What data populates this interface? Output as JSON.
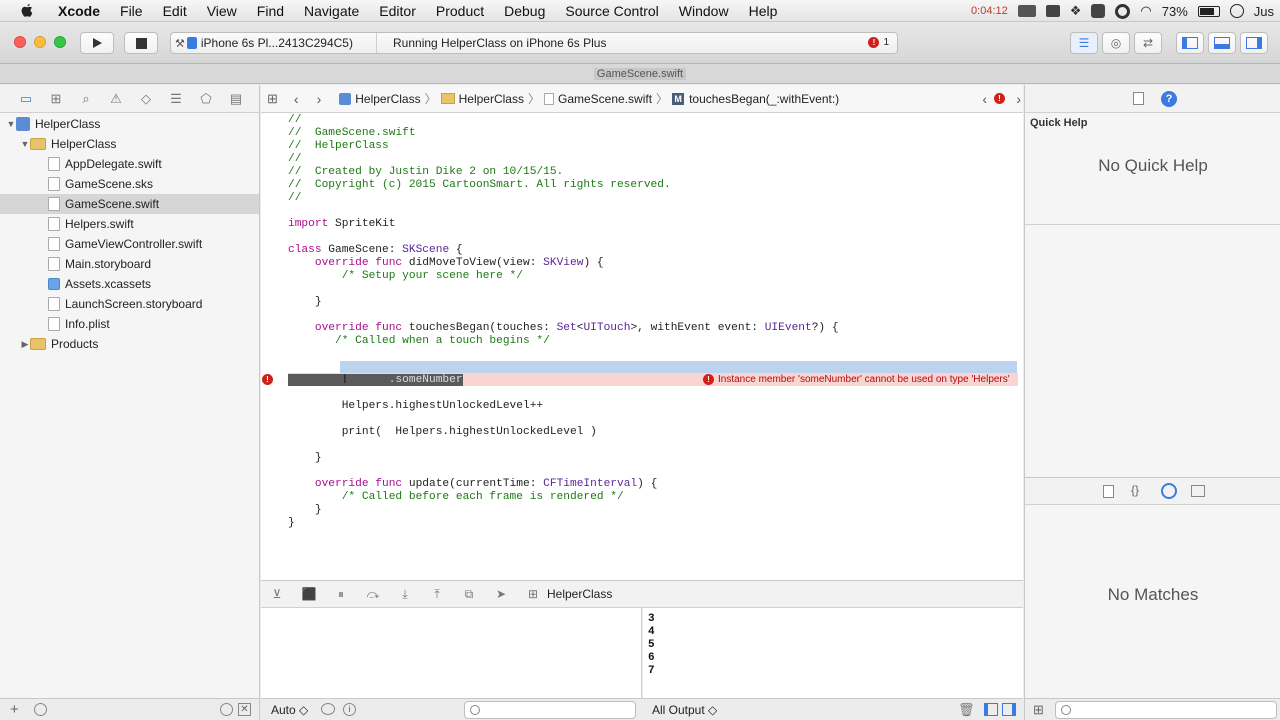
{
  "menubar": {
    "app": "Xcode",
    "items": [
      "File",
      "Edit",
      "View",
      "Find",
      "Navigate",
      "Editor",
      "Product",
      "Debug",
      "Source Control",
      "Window",
      "Help"
    ],
    "timer": "0:04:12",
    "battery": "73%",
    "user": "Jus"
  },
  "toolbar": {
    "scheme": "iPhone 6s Pl...2413C294C5)",
    "status": "Running HelperClass on iPhone 6s Plus",
    "error_count": "1"
  },
  "window_title": "GameScene.swift",
  "jumpbar": {
    "crumbs": [
      "HelperClass",
      "HelperClass",
      "GameScene.swift",
      "touchesBegan(_:withEvent:)"
    ]
  },
  "navigator": {
    "items": [
      {
        "label": "HelperClass",
        "kind": "project"
      },
      {
        "label": "HelperClass",
        "kind": "folder"
      },
      {
        "label": "AppDelegate.swift",
        "kind": "file"
      },
      {
        "label": "GameScene.sks",
        "kind": "file"
      },
      {
        "label": "GameScene.swift",
        "kind": "file"
      },
      {
        "label": "Helpers.swift",
        "kind": "file"
      },
      {
        "label": "GameViewController.swift",
        "kind": "file"
      },
      {
        "label": "Main.storyboard",
        "kind": "file"
      },
      {
        "label": "Assets.xcassets",
        "kind": "folder"
      },
      {
        "label": "LaunchScreen.storyboard",
        "kind": "file"
      },
      {
        "label": "Info.plist",
        "kind": "file"
      },
      {
        "label": "Products",
        "kind": "folder"
      }
    ]
  },
  "editor": {
    "error_message": "Instance member 'someNumber' cannot be used on type 'Helpers'",
    "selected_text": ".someNumber"
  },
  "debug": {
    "target": "HelperClass",
    "output": [
      "3",
      "4",
      "5",
      "6",
      "7"
    ],
    "auto_label": "Auto ◇",
    "output_filter": "All Output ◇"
  },
  "inspector": {
    "quick_help_title": "Quick Help",
    "no_quick_help": "No Quick Help",
    "no_matches": "No Matches"
  },
  "colors": {
    "error": "#d0201b",
    "selection": "#bcd3f0",
    "error_line": "#f9d4d2"
  }
}
